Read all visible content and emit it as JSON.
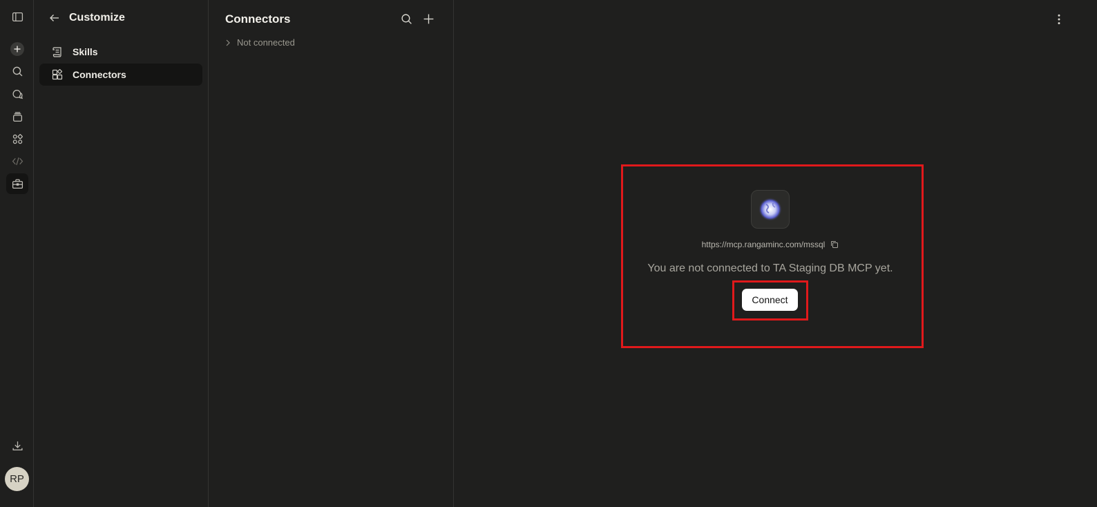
{
  "rail": {
    "avatar_initials": "RP",
    "icons": [
      "sidebar-toggle-icon",
      "new-chat-icon",
      "search-icon",
      "chats-icon",
      "projects-icon",
      "artifacts-icon",
      "code-icon",
      "customize-icon",
      "download-icon"
    ]
  },
  "customize": {
    "title": "Customize",
    "items": [
      {
        "label": "Skills",
        "icon": "skills-icon",
        "active": false
      },
      {
        "label": "Connectors",
        "icon": "connectors-icon",
        "active": true
      }
    ]
  },
  "connectors": {
    "title": "Connectors",
    "group_label": "Not connected"
  },
  "detail": {
    "url": "https://mcp.rangaminc.com/mssql",
    "message": "You are not connected to TA Staging DB MCP yet.",
    "connect_label": "Connect",
    "highlight_color": "#e0191b"
  },
  "colors": {
    "background": "#1f1f1e",
    "active_item": "#141413",
    "border": "#343432",
    "button_bg": "#ffffff"
  }
}
